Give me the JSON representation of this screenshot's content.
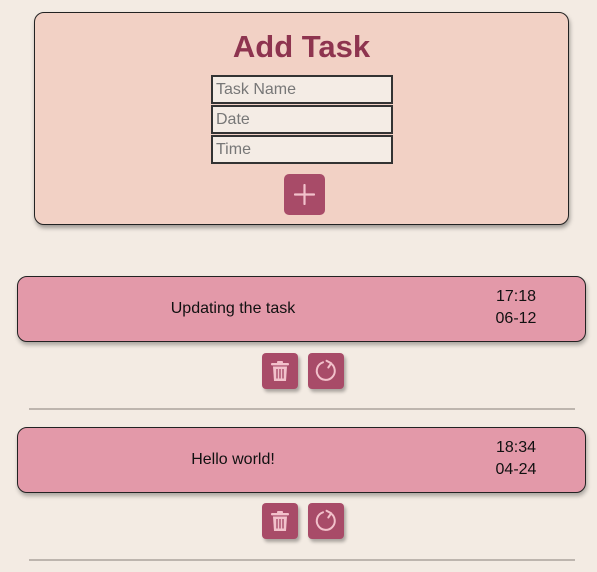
{
  "add_form": {
    "title": "Add Task",
    "name_placeholder": "Task Name",
    "date_placeholder": "Date",
    "time_placeholder": "Time",
    "add_icon": "plus-icon"
  },
  "tasks": [
    {
      "name": "Updating the task",
      "time": "17:18",
      "date": "06-12",
      "delete_icon": "trash-icon",
      "update_icon": "refresh-icon"
    },
    {
      "name": "Hello world!",
      "time": "18:34",
      "date": "04-24",
      "delete_icon": "trash-icon",
      "update_icon": "refresh-icon"
    }
  ],
  "colors": {
    "background": "#f3ebe3",
    "form_card": "#f2d1c5",
    "title": "#8e344f",
    "task_card": "#e399a9",
    "button": "#a84b68",
    "icon": "#f2c1cb"
  }
}
